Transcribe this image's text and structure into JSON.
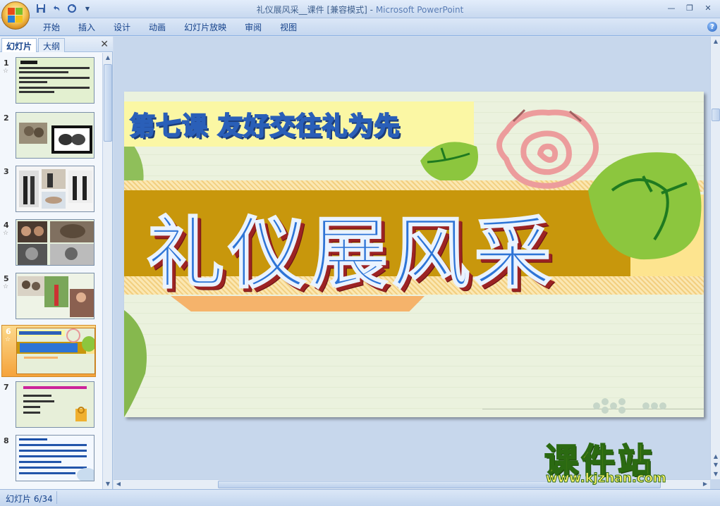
{
  "window": {
    "title": "礼仪展风采__课件 [兼容模式]",
    "title_separator": " - ",
    "app_name": "Microsoft PowerPoint"
  },
  "quick_access": {
    "save_icon": "save-icon",
    "undo_icon": "undo-icon",
    "redo_icon": "redo-icon",
    "customize_icon": "customize-qat-icon"
  },
  "ribbon": {
    "tabs": [
      "开始",
      "插入",
      "设计",
      "动画",
      "幻灯片放映",
      "审阅",
      "视图"
    ],
    "help_label": "?"
  },
  "left_pane": {
    "tab_slides": "幻灯片",
    "tab_outline": "大纲",
    "close_label": "✕",
    "slides": [
      {
        "number": "1",
        "star": "☆"
      },
      {
        "number": "2",
        "star": ""
      },
      {
        "number": "3",
        "star": ""
      },
      {
        "number": "4",
        "star": "☆"
      },
      {
        "number": "5",
        "star": "☆"
      },
      {
        "number": "6",
        "star": "☆"
      },
      {
        "number": "7",
        "star": ""
      },
      {
        "number": "8",
        "star": ""
      }
    ],
    "selected_index": 5
  },
  "slide": {
    "subtitle": "第七课  友好交往礼为先",
    "title": "礼仪展风采"
  },
  "watermark": {
    "chinese": "课件站",
    "url": "www.kjzhan.com"
  },
  "status": {
    "slide_info": "幻灯片 6/34"
  },
  "colors": {
    "ribbon_text": "#15428b",
    "selected_thumb": "#f5a33b",
    "title_blue": "#2d74d6",
    "band_gold": "#c8970c"
  }
}
